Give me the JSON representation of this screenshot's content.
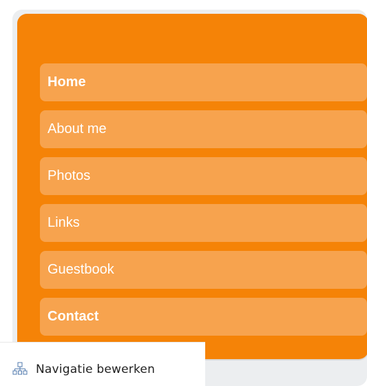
{
  "navigation": {
    "items": [
      {
        "label": "Home",
        "bold": true
      },
      {
        "label": "About me",
        "bold": false
      },
      {
        "label": "Photos",
        "bold": false
      },
      {
        "label": "Links",
        "bold": false
      },
      {
        "label": "Guestbook",
        "bold": false
      },
      {
        "label": "Contact",
        "bold": true
      }
    ]
  },
  "toolbar": {
    "edit_label": "Navigatie bewerken",
    "icon": "sitemap-icon"
  },
  "colors": {
    "panel": "#f58307",
    "nav_item": "#f7a34e",
    "nav_text": "#ffffff"
  }
}
